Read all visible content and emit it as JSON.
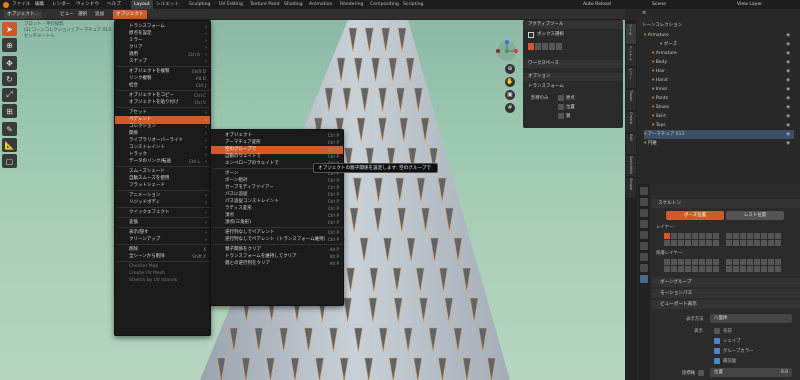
{
  "topbar": {
    "menu": [
      "ファイル",
      "編集",
      "レンダー",
      "ウィンドウ",
      "ヘルプ"
    ],
    "workspaces": [
      "Layout",
      "シルエット",
      "Sculpting",
      "UV Editing",
      "Texture Paint",
      "Shading",
      "Animation",
      "Rendering",
      "Compositing",
      "Scripting"
    ],
    "auto_reload": "Auto Reload",
    "scene": "Scene",
    "view_layer": "View Layer"
  },
  "header": {
    "mode": "オブジェクト...",
    "items": [
      "ビュー",
      "選択",
      "追加",
      "オブジェクト"
    ]
  },
  "viewport": {
    "info": [
      "フロント・平行投影",
      "(1) コーンコレクション | アーマチュア.013",
      "センチメートル"
    ]
  },
  "object_menu": {
    "items": [
      {
        "label": "トランスフォーム",
        "arrow": true
      },
      {
        "label": "原点を設定",
        "arrow": true
      },
      {
        "label": "ミラー",
        "arrow": true
      },
      {
        "label": "クリア",
        "arrow": true
      },
      {
        "label": "適用",
        "shortcut": "Ctrl A",
        "arrow": true
      },
      {
        "label": "スナップ",
        "arrow": true
      },
      {
        "sep": true
      },
      {
        "label": "オブジェクトを複製",
        "shortcut": "Shift D"
      },
      {
        "label": "リンク複製",
        "shortcut": "Alt D"
      },
      {
        "label": "結合",
        "shortcut": "Ctrl J"
      },
      {
        "sep": true
      },
      {
        "label": "オブジェクトをコピー",
        "shortcut": "Ctrl C"
      },
      {
        "label": "オブジェクトを貼り付け",
        "shortcut": "Ctrl V"
      },
      {
        "sep": true
      },
      {
        "label": "アセット",
        "arrow": true
      },
      {
        "label": "ペアレント",
        "arrow": true,
        "highlight": true
      },
      {
        "label": "コレクション",
        "arrow": true
      },
      {
        "label": "関係",
        "arrow": true
      },
      {
        "label": "ライブラリオーバーライド",
        "arrow": true
      },
      {
        "label": "コンストレイント",
        "arrow": true
      },
      {
        "label": "トラック",
        "arrow": true
      },
      {
        "label": "データのリンク/転送",
        "shortcut": "Ctrl L",
        "arrow": true
      },
      {
        "sep": true
      },
      {
        "label": "スムーズシェード"
      },
      {
        "label": "自動スムーズを使用"
      },
      {
        "label": "フラットシェード"
      },
      {
        "sep": true
      },
      {
        "label": "アニメーション",
        "arrow": true
      },
      {
        "label": "リジッドボディ",
        "arrow": true
      },
      {
        "sep": true
      },
      {
        "label": "クイックエフェクト",
        "arrow": true
      },
      {
        "sep": true
      },
      {
        "label": "変換",
        "arrow": true
      },
      {
        "sep": true
      },
      {
        "label": "表示/隠す",
        "arrow": true
      },
      {
        "label": "クリーンアップ",
        "arrow": true
      },
      {
        "sep": true
      },
      {
        "label": "削除",
        "shortcut": "X"
      },
      {
        "label": "全シーンから削除",
        "shortcut": "Shift X"
      },
      {
        "sep": true
      },
      {
        "label": "Checker Map",
        "dim": true
      },
      {
        "label": "Create UV Mesh",
        "dim": true
      },
      {
        "label": "Stretch by UV Islands",
        "dim": true
      }
    ]
  },
  "parent_menu": {
    "items": [
      {
        "label": "オブジェクト",
        "shortcut": "Ctrl P"
      },
      {
        "label": "アーマチュア変形",
        "shortcut": "Ctrl P"
      },
      {
        "label": "空のグループで",
        "shortcut": "Ctrl P",
        "highlight": true
      },
      {
        "label": "自動のウェイトで",
        "shortcut": "Ctrl P"
      },
      {
        "label": "エンベロープのウェイトで",
        "shortcut": "Ctrl P"
      },
      {
        "sep": true
      },
      {
        "label": "ボーン",
        "shortcut": "Ctrl P"
      },
      {
        "label": "ボーン相対",
        "shortcut": "Ctrl P"
      },
      {
        "label": "カーブモディファイアー",
        "shortcut": "Ctrl P"
      },
      {
        "label": "パスに追従",
        "shortcut": "Ctrl P"
      },
      {
        "label": "パス追従コンストレイント",
        "shortcut": "Ctrl P"
      },
      {
        "label": "ラティス変形",
        "shortcut": "Ctrl P"
      },
      {
        "label": "頂点",
        "shortcut": "Ctrl P"
      },
      {
        "label": "頂点(三角形)",
        "shortcut": "Ctrl P"
      },
      {
        "sep": true
      },
      {
        "label": "逆行列なしでペアレント",
        "shortcut": "Ctrl P"
      },
      {
        "label": "逆行列なしでペアレント（トランスフォーム維持）",
        "shortcut": "Ctrl P"
      },
      {
        "sep": true
      },
      {
        "label": "親子関係をクリア",
        "shortcut": "Alt P"
      },
      {
        "label": "トランスフォームを維持してクリア",
        "shortcut": "Alt P"
      },
      {
        "label": "親との逆行列をクリア",
        "shortcut": "Alt P"
      }
    ]
  },
  "tooltip": "オブジェクトの親子関係を設定します:  空のグループで",
  "active_tool": {
    "title": "アクティブツール",
    "tool": "ボックス選択",
    "workspace": "ワークスペース",
    "options": "オプション",
    "transform": "トランスフォーム",
    "affect_only": "影響のみ",
    "opt_origin": "原点",
    "opt_location": "位置",
    "opt_parent": "親"
  },
  "outliner": {
    "title": "シーンコレクション",
    "rows": [
      {
        "label": "Armature",
        "indent": 0
      },
      {
        "label": "ポーズ",
        "indent": 2
      },
      {
        "label": "Armature",
        "indent": 1
      },
      {
        "label": "Body",
        "indent": 1
      },
      {
        "label": "Hair",
        "indent": 1
      },
      {
        "label": "Hand",
        "indent": 1
      },
      {
        "label": "Inner",
        "indent": 1
      },
      {
        "label": "Pants",
        "indent": 1
      },
      {
        "label": "Shoes",
        "indent": 1
      },
      {
        "label": "Skirt",
        "indent": 1
      },
      {
        "label": "Tops",
        "indent": 1
      },
      {
        "label": "アーマチュア.013",
        "indent": 0,
        "selected": true
      },
      {
        "label": "円錐",
        "indent": 0
      }
    ]
  },
  "side_tabs": [
    "ツール",
    "アイテム",
    "ビュー",
    "Tissue",
    "Create",
    "Edit",
    "Sketchfab",
    "Simple Anim"
  ],
  "properties": {
    "section": "スケルトン",
    "pose_position": "ポーズ位置",
    "rest_position": "レスト位置",
    "layers": "レイヤー:",
    "protected_layers": "保護レイヤー:",
    "bone_groups": "ボーングループ",
    "motion_paths": "モーションパス",
    "viewport_display": "ビューポート表示",
    "display_as_label": "表示方法",
    "display_as_value": "八面体",
    "show_label": "表示",
    "show_items": [
      {
        "label": "名前",
        "on": false
      },
      {
        "label": "シェイプ",
        "on": true
      },
      {
        "label": "グループカラー",
        "on": true
      },
      {
        "label": "最前面",
        "on": true
      }
    ],
    "axes_label": "座標軸",
    "axes_pos_label": "位置",
    "axes_pos_value": "0.0"
  },
  "accent": "#cf5a2c"
}
